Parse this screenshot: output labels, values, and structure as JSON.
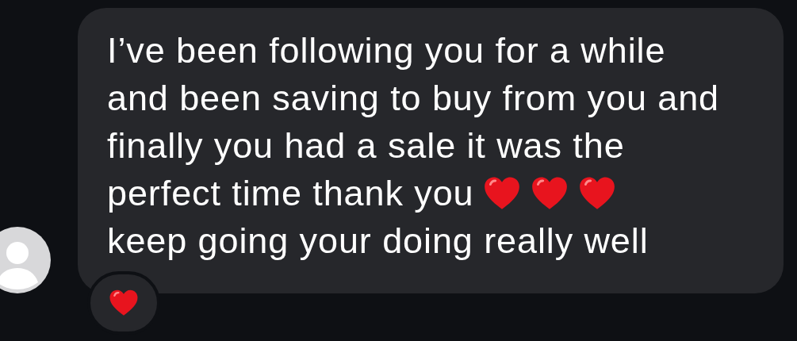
{
  "message": {
    "lines": [
      {
        "text": "I’ve been following you for a while"
      },
      {
        "text": "and been saving to buy from you and"
      },
      {
        "text": "finally you had a sale it was the"
      },
      {
        "text": "perfect time thank you",
        "emoji": [
          {
            "kind": "heart"
          },
          {
            "kind": "heart"
          },
          {
            "kind": "heart"
          }
        ]
      },
      {
        "text": "keep going your doing really well"
      }
    ],
    "reaction": {
      "kind": "heart"
    }
  }
}
